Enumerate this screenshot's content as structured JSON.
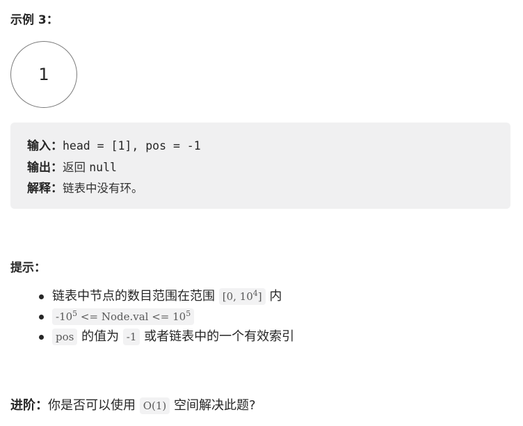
{
  "example": {
    "heading": "示例 3：",
    "node_value": "1",
    "input_label": "输入：",
    "input_value": "head = [1], pos = -1",
    "output_label": "输出：",
    "output_text": "返回 ",
    "output_value": "null",
    "explain_label": "解释：",
    "explain_text": "链表中没有环。"
  },
  "hints": {
    "heading": "提示：",
    "item1": {
      "before": "链表中节点的数目范围在范围 ",
      "code_base": "[0, 10",
      "code_exp": "4",
      "code_end": "]",
      "after": " 内"
    },
    "item2": {
      "code_a": "-10",
      "exp_a": "5",
      "code_mid": " <= Node.val <= 10",
      "exp_b": "5"
    },
    "item3": {
      "code1": "pos",
      "mid": " 的值为 ",
      "code2": "-1",
      "after": " 或者链表中的一个有效索引"
    }
  },
  "advanced": {
    "label": "进阶：",
    "before": "你是否可以使用 ",
    "code": "O(1)",
    "after": " 空间解决此题?"
  }
}
